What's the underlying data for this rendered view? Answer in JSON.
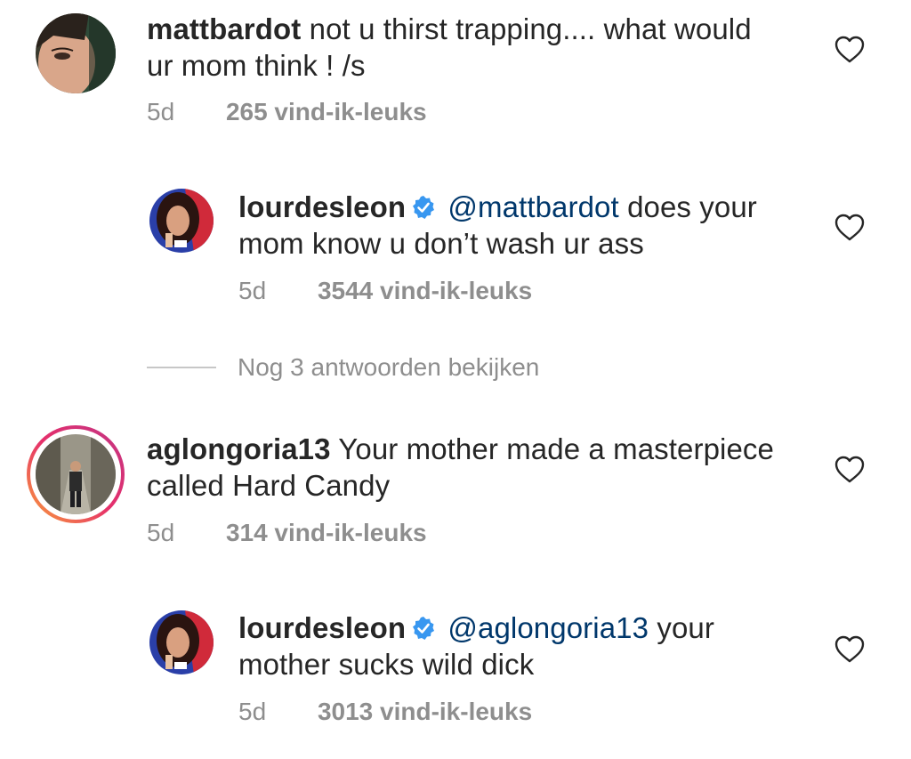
{
  "comments": [
    {
      "username": "mattbardot",
      "verified": false,
      "mention": "",
      "line1": "not u thirst trapping.... what would",
      "line2": "ur mom think ! /s",
      "time": "5d",
      "likes": "265 vind-ik-leuks"
    },
    {
      "username": "lourdesleon",
      "verified": true,
      "mention": "@mattbardot",
      "line1": "does your",
      "line2": "mom know u don’t wash ur ass",
      "time": "5d",
      "likes": "3544 vind-ik-leuks"
    },
    {
      "username": "aglongoria13",
      "verified": false,
      "mention": "",
      "line1": "Your mother made a masterpiece",
      "line2": "called Hard Candy",
      "time": "5d",
      "likes": "314 vind-ik-leuks"
    },
    {
      "username": "lourdesleon",
      "verified": true,
      "mention": "@aglongoria13",
      "line1": "your",
      "line2": "mother sucks wild dick",
      "time": "5d",
      "likes": "3013 vind-ik-leuks"
    }
  ],
  "view_replies": {
    "label": "Nog 3 antwoorden bekijken"
  },
  "icons": {
    "like": "heart-outline-icon",
    "verified": "verified-badge-icon"
  },
  "colors": {
    "text": "#262626",
    "secondary": "#8e8e8e",
    "mention": "#00376b",
    "verified": "#3897f0"
  }
}
